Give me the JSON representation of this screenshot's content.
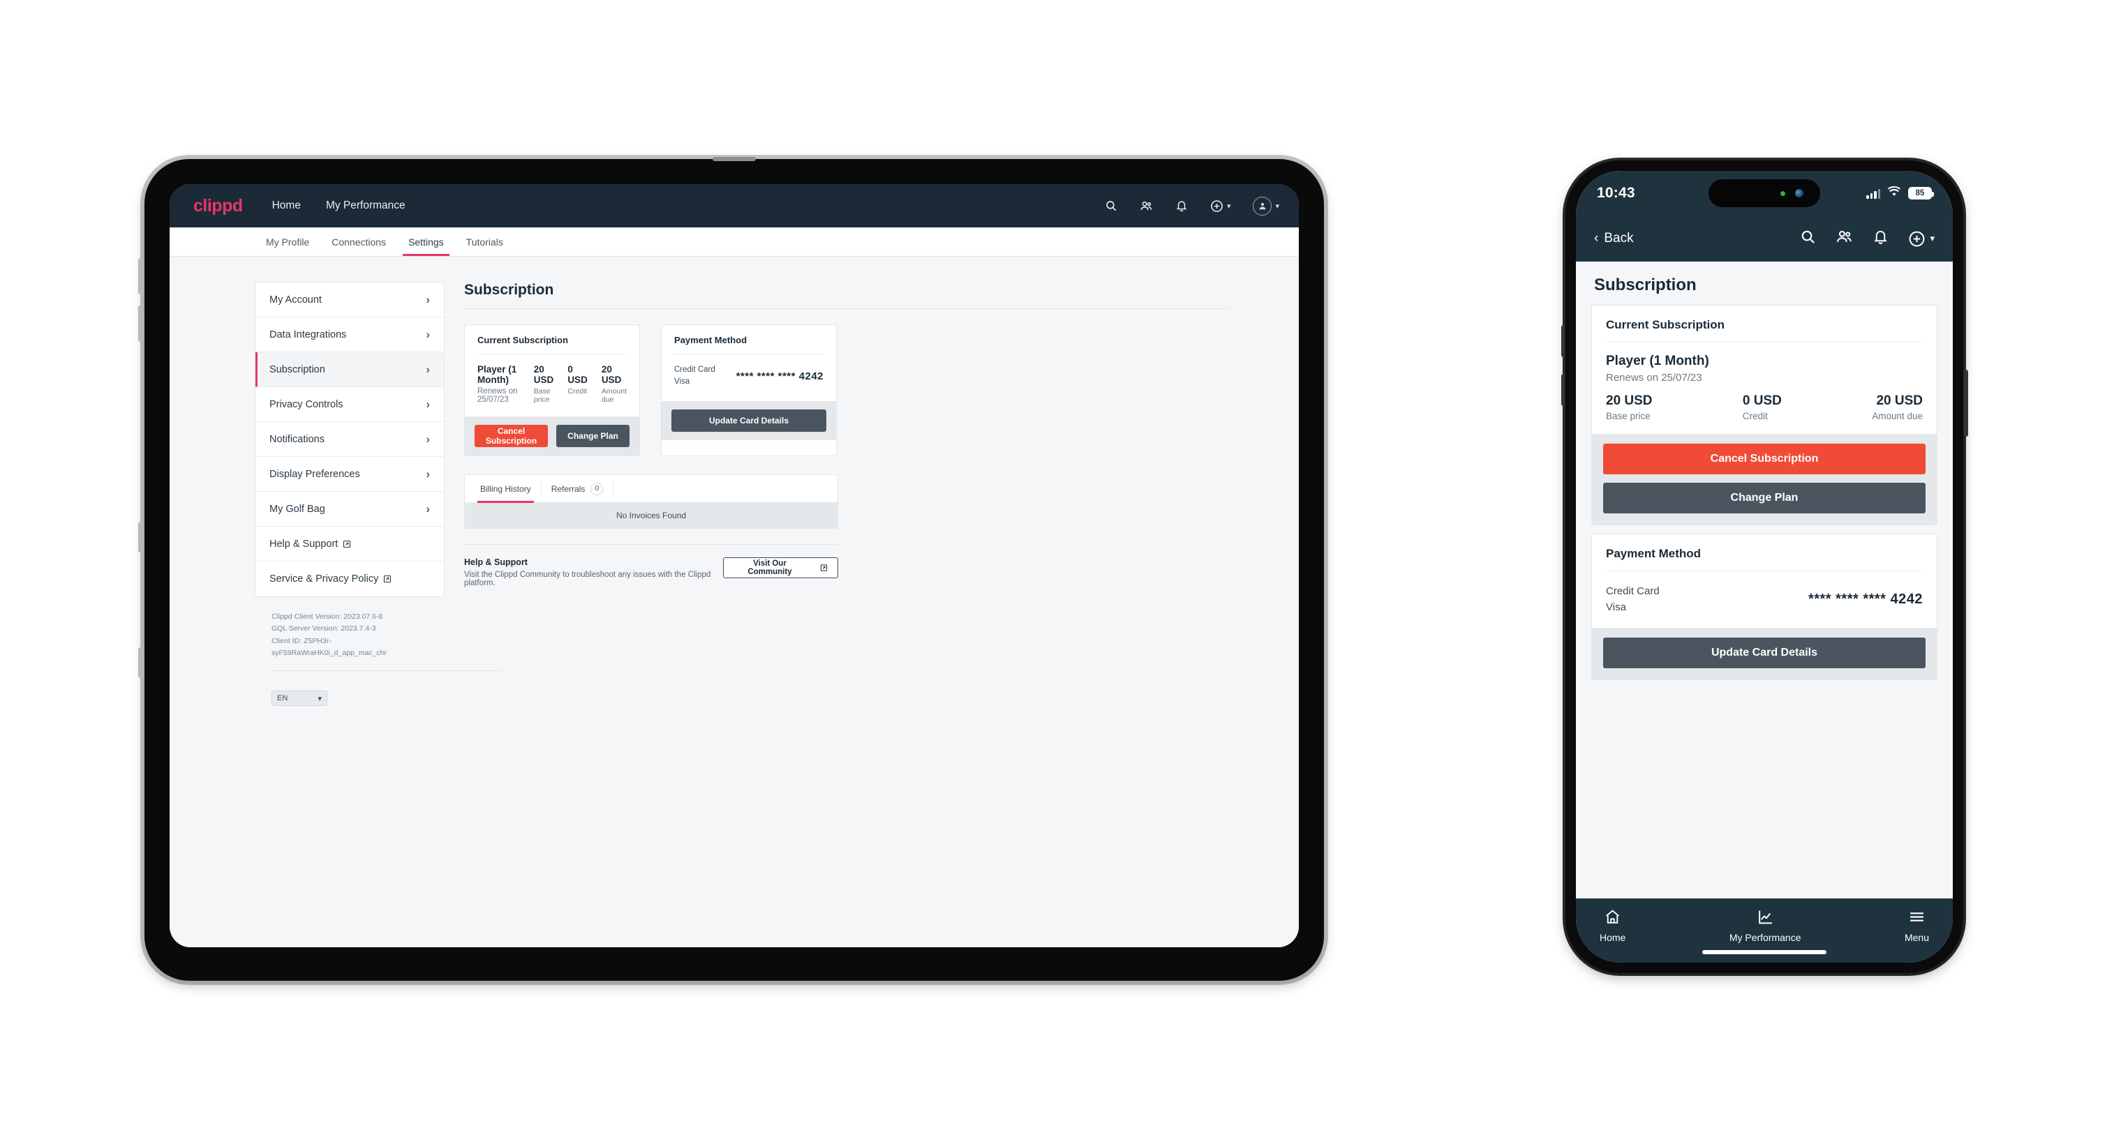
{
  "tablet": {
    "brand": "clippd",
    "topnav": [
      "Home",
      "My Performance"
    ],
    "subtabs": [
      {
        "label": "My Profile",
        "active": false
      },
      {
        "label": "Connections",
        "active": false
      },
      {
        "label": "Settings",
        "active": true
      },
      {
        "label": "Tutorials",
        "active": false
      }
    ],
    "sidebar": [
      {
        "label": "My Account",
        "active": false,
        "external": false
      },
      {
        "label": "Data Integrations",
        "active": false,
        "external": false
      },
      {
        "label": "Subscription",
        "active": true,
        "external": false
      },
      {
        "label": "Privacy Controls",
        "active": false,
        "external": false
      },
      {
        "label": "Notifications",
        "active": false,
        "external": false
      },
      {
        "label": "Display Preferences",
        "active": false,
        "external": false
      },
      {
        "label": "My Golf Bag",
        "active": false,
        "external": false
      },
      {
        "label": "Help & Support",
        "active": false,
        "external": true
      },
      {
        "label": "Service & Privacy Policy",
        "active": false,
        "external": true
      }
    ],
    "versions": [
      "Clippd Client Version: 2023.07.6-8",
      "GQL Server Version: 2023.7.4-3",
      "Client ID: Z5PH3r-syF59RaWraHK0i_d_app_mac_chr"
    ],
    "language": "EN",
    "page_title": "Subscription",
    "current_subscription": {
      "card_title": "Current Subscription",
      "plan": "Player (1 Month)",
      "renews": "Renews on 25/07/23",
      "amounts": [
        {
          "value": "20 USD",
          "label": "Base price"
        },
        {
          "value": "0 USD",
          "label": "Credit"
        },
        {
          "value": "20 USD",
          "label": "Amount due"
        }
      ],
      "cancel_label": "Cancel Subscription",
      "change_label": "Change Plan"
    },
    "payment_method": {
      "card_title": "Payment Method",
      "type": "Credit Card",
      "brand": "Visa",
      "number": "**** **** **** 4242",
      "update_label": "Update Card Details"
    },
    "billing": {
      "tabs": [
        {
          "label": "Billing History",
          "active": true,
          "badge": null
        },
        {
          "label": "Referrals",
          "active": false,
          "badge": "0"
        }
      ],
      "empty": "No Invoices Found"
    },
    "help": {
      "title": "Help & Support",
      "description": "Visit the Clippd Community to troubleshoot any issues with the Clippd platform.",
      "button": "Visit Our Community"
    }
  },
  "phone": {
    "status": {
      "time": "10:43",
      "battery": "85"
    },
    "nav": {
      "back": "Back"
    },
    "page_title": "Subscription",
    "current_subscription": {
      "card_title": "Current Subscription",
      "plan": "Player (1 Month)",
      "renews": "Renews on 25/07/23",
      "amounts": [
        {
          "value": "20 USD",
          "label": "Base price"
        },
        {
          "value": "0 USD",
          "label": "Credit"
        },
        {
          "value": "20 USD",
          "label": "Amount due"
        }
      ],
      "cancel_label": "Cancel Subscription",
      "change_label": "Change Plan"
    },
    "payment_method": {
      "card_title": "Payment Method",
      "type": "Credit Card",
      "brand": "Visa",
      "number": "**** **** **** 4242",
      "update_label": "Update Card Details"
    },
    "tabbar": [
      {
        "label": "Home",
        "icon": "home-icon"
      },
      {
        "label": "My Performance",
        "icon": "chart-icon"
      },
      {
        "label": "Menu",
        "icon": "hamburger-icon"
      }
    ]
  },
  "colors": {
    "navy": "#1b2a36",
    "navy_phone": "#1f333f",
    "accent_pink": "#e5376a",
    "danger_red": "#ef4b36",
    "slate": "#4a5560",
    "page_bg": "#f4f6f8"
  }
}
